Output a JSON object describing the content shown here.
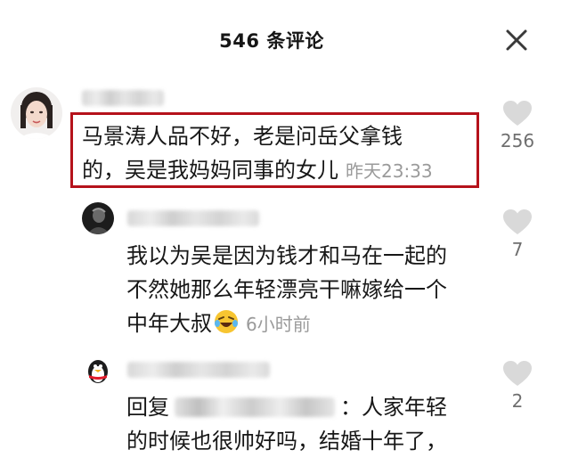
{
  "header": {
    "title": "546 条评论"
  },
  "comments": [
    {
      "text_line1": "马景涛人品不好，老是问岳父拿钱",
      "text_line2": "的，吴是我妈妈同事的女儿",
      "timestamp": "昨天23:33",
      "likes": "256"
    },
    {
      "text_line1": "我以为吴是因为钱才和马在一起的",
      "text_line2": "不然她那么年轻漂亮干嘛嫁给一个",
      "text_line3": "中年大叔",
      "timestamp": "6小时前",
      "likes": "7"
    },
    {
      "reply_prefix": "回复",
      "reply_suffix": "：人家年轻",
      "text_line2": "的时候也很帅好吗，结婚十年了，",
      "likes": "2"
    }
  ],
  "colors": {
    "highlight_border": "#b5121b",
    "timestamp": "#9a9a9a",
    "like_icon": "#d9d9d9"
  },
  "icons": {
    "close": "close-icon",
    "like": "heart-icon",
    "emoji": "laughing-crying-emoji-icon"
  }
}
